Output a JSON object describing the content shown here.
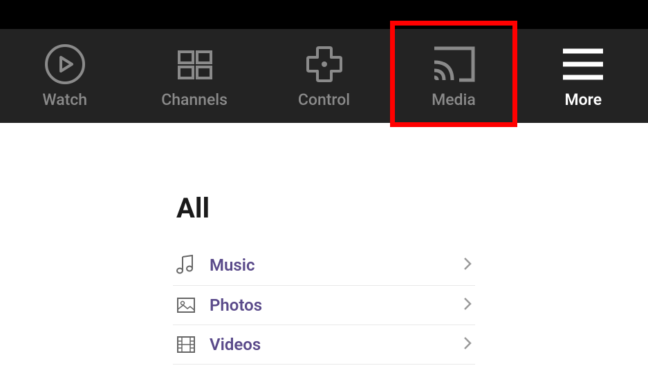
{
  "nav": {
    "items": [
      {
        "label": "Watch",
        "icon": "play-circle"
      },
      {
        "label": "Channels",
        "icon": "grid"
      },
      {
        "label": "Control",
        "icon": "dpad"
      },
      {
        "label": "Media",
        "icon": "cast",
        "highlighted": true
      },
      {
        "label": "More",
        "icon": "hamburger",
        "active": true
      }
    ]
  },
  "content": {
    "section_title": "All",
    "list": [
      {
        "label": "Music",
        "icon": "music"
      },
      {
        "label": "Photos",
        "icon": "photo"
      },
      {
        "label": "Videos",
        "icon": "video"
      }
    ]
  },
  "colors": {
    "nav_bg": "#232323",
    "list_accent": "#5a4a8a",
    "highlight": "#ff0000"
  }
}
